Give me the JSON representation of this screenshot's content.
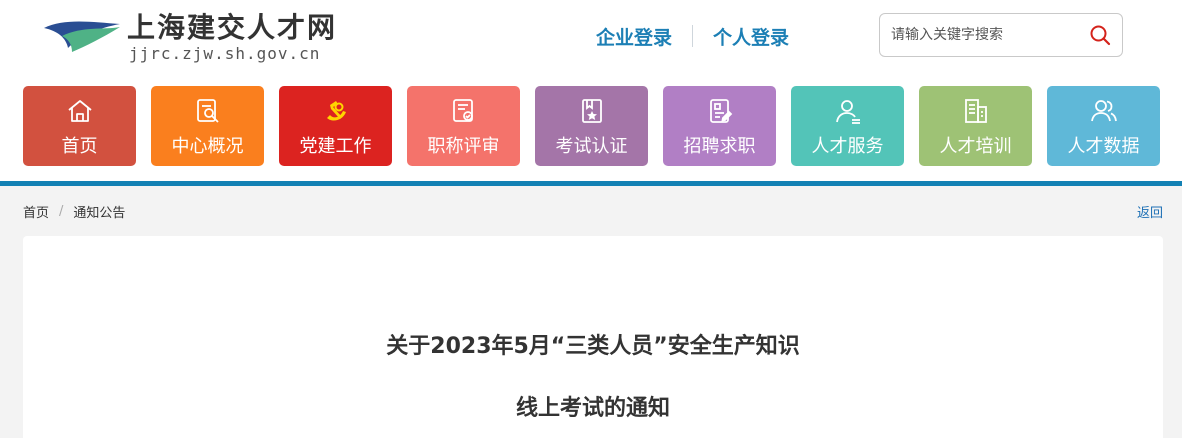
{
  "header": {
    "site_name": "上海建交人才网",
    "site_domain": "jjrc.zjw.sh.gov.cn",
    "logo_icon": "wing-logo-icon",
    "login_links": [
      "企业登录",
      "个人登录"
    ],
    "link_color": "#1c7fb5"
  },
  "search": {
    "placeholder": "请输入关键字搜索",
    "icon": "search-icon",
    "icon_color": "#d4231b"
  },
  "nav": {
    "items": [
      {
        "label": "首页",
        "icon": "home-icon",
        "color": "#d2513f"
      },
      {
        "label": "中心概况",
        "icon": "search-doc-icon",
        "color": "#fa7f1e"
      },
      {
        "label": "党建工作",
        "icon": "party-emblem-icon",
        "color": "#dc2320"
      },
      {
        "label": "职称评审",
        "icon": "certificate-icon",
        "color": "#f4736b"
      },
      {
        "label": "考试认证",
        "icon": "exam-book-icon",
        "color": "#a475a8"
      },
      {
        "label": "招聘求职",
        "icon": "resume-icon",
        "color": "#b17fc5"
      },
      {
        "label": "人才服务",
        "icon": "user-service-icon",
        "color": "#53c4b8"
      },
      {
        "label": "人才培训",
        "icon": "building-icon",
        "color": "#9ec275"
      },
      {
        "label": "人才数据",
        "icon": "users-icon",
        "color": "#5fb8d8"
      }
    ]
  },
  "accent_color": "#1381b4",
  "breadcrumb": {
    "items": [
      "首页",
      "通知公告"
    ],
    "separator": "/"
  },
  "back_label": "返回",
  "article": {
    "title_line1": "关于2023年5月“三类人员”安全生产知识",
    "title_line2": "线上考试的通知"
  }
}
